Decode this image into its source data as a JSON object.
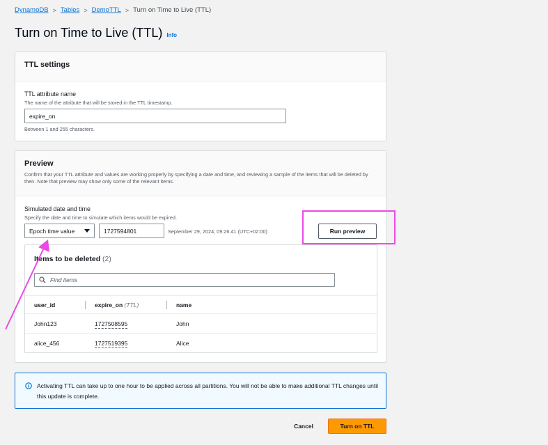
{
  "breadcrumb": {
    "items": [
      "DynamoDB",
      "Tables",
      "DemoTTL"
    ],
    "current": "Turn on Time to Live (TTL)"
  },
  "page": {
    "title": "Turn on Time to Live (TTL)",
    "info_label": "Info"
  },
  "ttl_settings": {
    "title": "TTL settings",
    "attribute_label": "TTL attribute name",
    "attribute_description": "The name of the attribute that will be stored in the TTL timestamp.",
    "attribute_value": "expire_on",
    "attribute_constraint": "Between 1 and 255 characters."
  },
  "preview": {
    "title": "Preview",
    "description": "Confirm that your TTL attribute and values are working properly by specifying a date and time, and reviewing a sample of the items that will be deleted by then. Note that preview may show only some of the relevant items.",
    "simulated_label": "Simulated date and time",
    "simulated_description": "Specify the date and time to simulate which items would be expired.",
    "format_selected": "Epoch time value",
    "epoch_value": "1727594801",
    "epoch_readable": "September 29, 2024, 09:26:41 (UTC+02:00)",
    "run_button": "Run preview"
  },
  "items_table": {
    "title": "Items to be deleted",
    "count": "(2)",
    "search_placeholder": "Find items",
    "columns": {
      "user_id": "user_id",
      "expire_on": "expire_on",
      "expire_on_tag": "(TTL)",
      "name": "name"
    },
    "rows": [
      {
        "user_id": "John123",
        "expire_on": "1727508595",
        "name": "John"
      },
      {
        "user_id": "alice_456",
        "expire_on": "1727519395",
        "name": "Alice"
      }
    ]
  },
  "alert": {
    "text": "Activating TTL can take up to one hour to be applied across all partitions. You will not be able to make additional TTL changes until this update is complete."
  },
  "footer": {
    "cancel_label": "Cancel",
    "submit_label": "Turn on TTL"
  },
  "colors": {
    "link": "#0972d3",
    "primary": "#ff9900",
    "annotation": "#ea4ae4"
  }
}
